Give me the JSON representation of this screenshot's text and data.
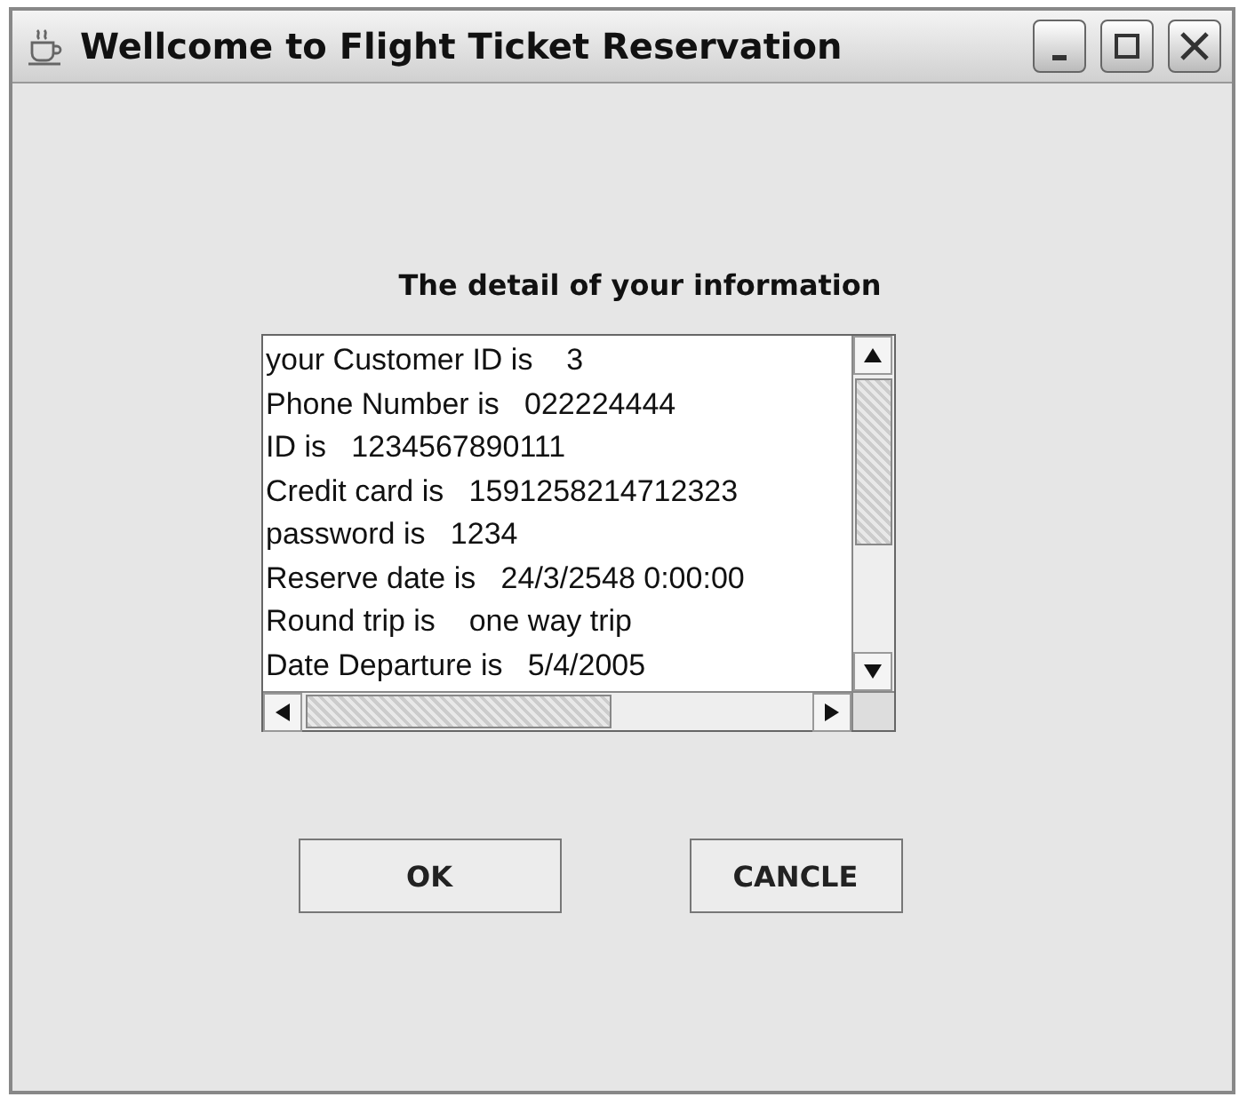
{
  "window": {
    "title": "Wellcome to Flight Ticket Reservation"
  },
  "heading": "The detail of your information",
  "details": [
    "your Customer ID is    3",
    "Phone Number is   022224444",
    "ID is   1234567890111",
    "Credit card is   1591258214712323",
    "password is   1234",
    "Reserve date is   24/3/2548 0:00:00",
    "Round trip is    one way trip",
    "Date Departure is   5/4/2005"
  ],
  "buttons": [
    "OK",
    "CANCLE"
  ]
}
